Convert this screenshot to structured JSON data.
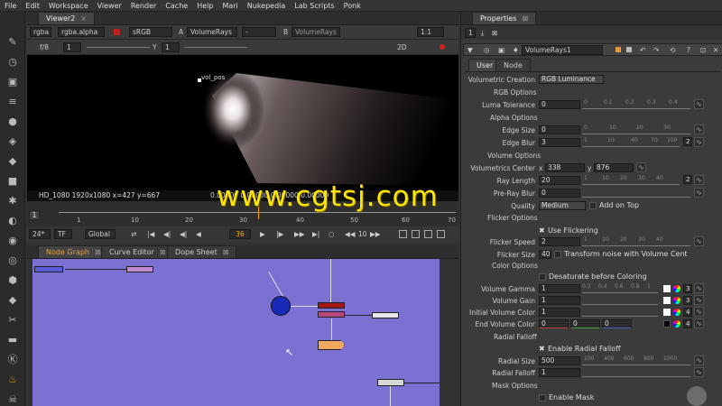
{
  "menu": [
    "File",
    "Edit",
    "Workspace",
    "Viewer",
    "Render",
    "Cache",
    "Help",
    "Mari",
    "Nukepedia",
    "Lab Scripts",
    "Ponk"
  ],
  "viewer_tab": {
    "label": "Viewer2",
    "close": "×"
  },
  "viewer_controls": {
    "channels": "rgba",
    "channel_alpha": "rgba.alpha",
    "colorspace": "sRGB",
    "input_a_label": "A",
    "input_a": "VolumeRays",
    "input_mid": "-",
    "input_b_label": "B",
    "input_b": "VolumeRays",
    "zoom": "1:1",
    "fstop": "f/8",
    "y_label": "Y",
    "y_value": "1",
    "frame_value": "1",
    "proj": "2D"
  },
  "viewer": {
    "point_label": "vol_pos",
    "info": "HD_1080 1920x1080  x=427 y=667",
    "values": "0.00000  0.00000  0.00000  0.00000"
  },
  "timeline": {
    "ticks": [
      "1",
      "10",
      "20",
      "30",
      "40",
      "50",
      "60",
      "70"
    ],
    "fps": "24*",
    "tf": "TF",
    "global": "Global",
    "current_frame": "36",
    "step": "10"
  },
  "bottom_tabs": [
    {
      "label": "Node Graph"
    },
    {
      "label": "Curve Editor"
    },
    {
      "label": "Dope Sheet"
    }
  ],
  "watermark": "www.cgtsj.com",
  "properties": {
    "tab": "Properties",
    "node_name": "VolumeRays1",
    "pane_count": "1",
    "subtabs": [
      "User",
      "Node"
    ],
    "volumetric_creation_label": "Volumetric Creation",
    "volumetric_creation": "RGB Luminance",
    "rgb_options": "RGB Options",
    "luma_tolerance_label": "Luma Tolerance",
    "luma_tolerance": "0",
    "alpha_options": "Alpha Options",
    "edge_size_label": "Edge Size",
    "edge_size": "0",
    "edge_blur_label": "Edge Blur",
    "edge_blur": "3",
    "volume_options": "Volume Options",
    "vol_center_label": "Volumetrics Center",
    "vol_center_x_label": "x",
    "vol_center_x": "338",
    "vol_center_y_label": "y",
    "vol_center_y": "876",
    "ray_length_label": "Ray Length",
    "ray_length": "20",
    "pre_ray_blur_label": "Pre-Ray Blur",
    "pre_ray_blur": "0",
    "quality_label": "Quality",
    "quality": "Medium",
    "add_on_top": "Add on Top",
    "flicker_options": "Flicker Options",
    "use_flickering": "Use Flickering",
    "flicker_speed_label": "Flicker Speed",
    "flicker_speed": "2",
    "flicker_size_label": "Flicker Size",
    "flicker_size": "40",
    "transform_noise": "Transform noise with Volume Cent",
    "color_options": "Color Options",
    "desaturate": "Desaturate before Coloring",
    "volume_gamma_label": "Volume Gamma",
    "volume_gamma": "1",
    "volume_gain_label": "Volume Gain",
    "volume_gain": "1",
    "initial_color_label": "Initial Volume Color",
    "initial_color": "1",
    "end_color_label": "End Volume Color",
    "end_color": [
      "0",
      "0",
      "0"
    ],
    "radial_falloff": "Radial Falloff",
    "enable_radial": "Enable Radial Falloff",
    "radial_size_label": "Radial Size",
    "radial_size": "500",
    "radial_falloff_label": "Radial Falloff",
    "radial_falloff_val": "1",
    "mask_options": "Mask Options",
    "enable_mask": "Enable Mask",
    "count_3": "3",
    "count_4": "4",
    "count_2": "2"
  },
  "slider_ticks": {
    "unit": [
      "0",
      "0.1",
      "0.2",
      "0.3",
      "0.4",
      "0.5",
      "0.6",
      "0.7",
      "0.8",
      "0.9"
    ],
    "edge": [
      "0",
      "10",
      "20",
      "30",
      "40"
    ],
    "blur": [
      "1",
      "10",
      "40",
      "70",
      "100"
    ],
    "ray": [
      "1",
      "10",
      "20",
      "30",
      "40",
      "50"
    ],
    "speed": [
      "1",
      "10",
      "20",
      "30",
      "40",
      "50"
    ],
    "gamma": [
      "0.2",
      "0.4",
      "0.6",
      "0.8",
      "1",
      "1.2",
      "1.4",
      "1.6",
      "1.8"
    ],
    "radial": [
      "200",
      "400",
      "600",
      "800",
      "1000",
      "1200",
      "1400",
      "1600",
      "1800"
    ]
  },
  "colors": {
    "accent": "#ffa500",
    "nodegraph_bg": "#7b71d2",
    "watermark": "#ffe600"
  }
}
